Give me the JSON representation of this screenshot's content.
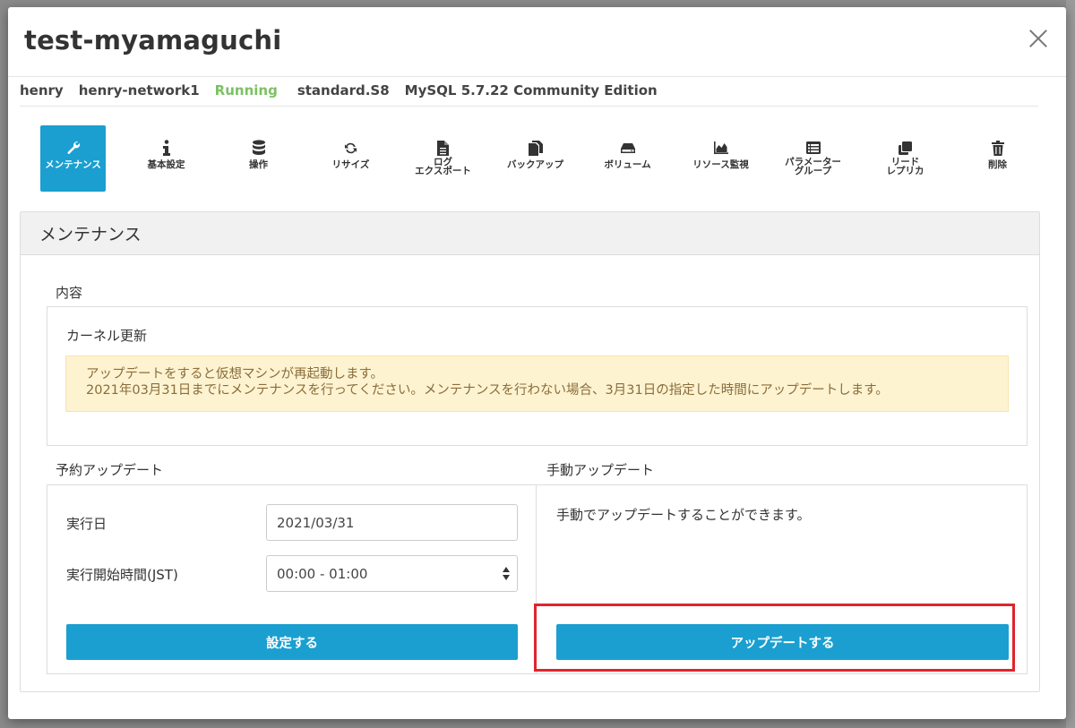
{
  "modal": {
    "title": "test-myamaguchi"
  },
  "info": {
    "user": "henry",
    "network": "henry-network1",
    "status": "Running",
    "plan": "standard.S8",
    "engine": "MySQL 5.7.22 Community Edition"
  },
  "toolbar": [
    {
      "icon": "wrench-icon",
      "label": "メンテナンス",
      "active": true
    },
    {
      "icon": "info-icon",
      "label": "基本設定"
    },
    {
      "icon": "database-icon",
      "label": "操作"
    },
    {
      "icon": "refresh-icon",
      "label": "リサイズ"
    },
    {
      "icon": "file-icon",
      "label": "ログ\nエクスポート"
    },
    {
      "icon": "copy-icon",
      "label": "バックアップ"
    },
    {
      "icon": "hdd-icon",
      "label": "ボリューム"
    },
    {
      "icon": "area-chart-icon",
      "label": "リソース監視"
    },
    {
      "icon": "list-alt-icon",
      "label": "パラメーター\nグループ"
    },
    {
      "icon": "clone-icon",
      "label": "リード\nレプリカ"
    },
    {
      "icon": "trash-icon",
      "label": "削除"
    }
  ],
  "panel": {
    "title": "メンテナンス",
    "content_label": "内容",
    "content": {
      "heading": "カーネル更新",
      "alert_line1": "アップデートをすると仮想マシンが再起動します。",
      "alert_line2": "2021年03月31日までにメンテナンスを行ってください。メンテナンスを行わない場合、3月31日の指定した時間にアップデートします。"
    },
    "scheduled": {
      "label": "予約アップデート",
      "date_label": "実行日",
      "date_value": "2021/03/31",
      "time_label": "実行開始時間(JST)",
      "time_value": "00:00 - 01:00",
      "submit_label": "設定する"
    },
    "manual": {
      "label": "手動アップデート",
      "description": "手動でアップデートすることができます。",
      "submit_label": "アップデートする"
    }
  },
  "colors": {
    "accent": "#1a9fd0",
    "status_running": "#7cc163",
    "alert_bg": "#fdf3d1",
    "alert_text": "#8a6d3b",
    "highlight": "#e0242d"
  }
}
